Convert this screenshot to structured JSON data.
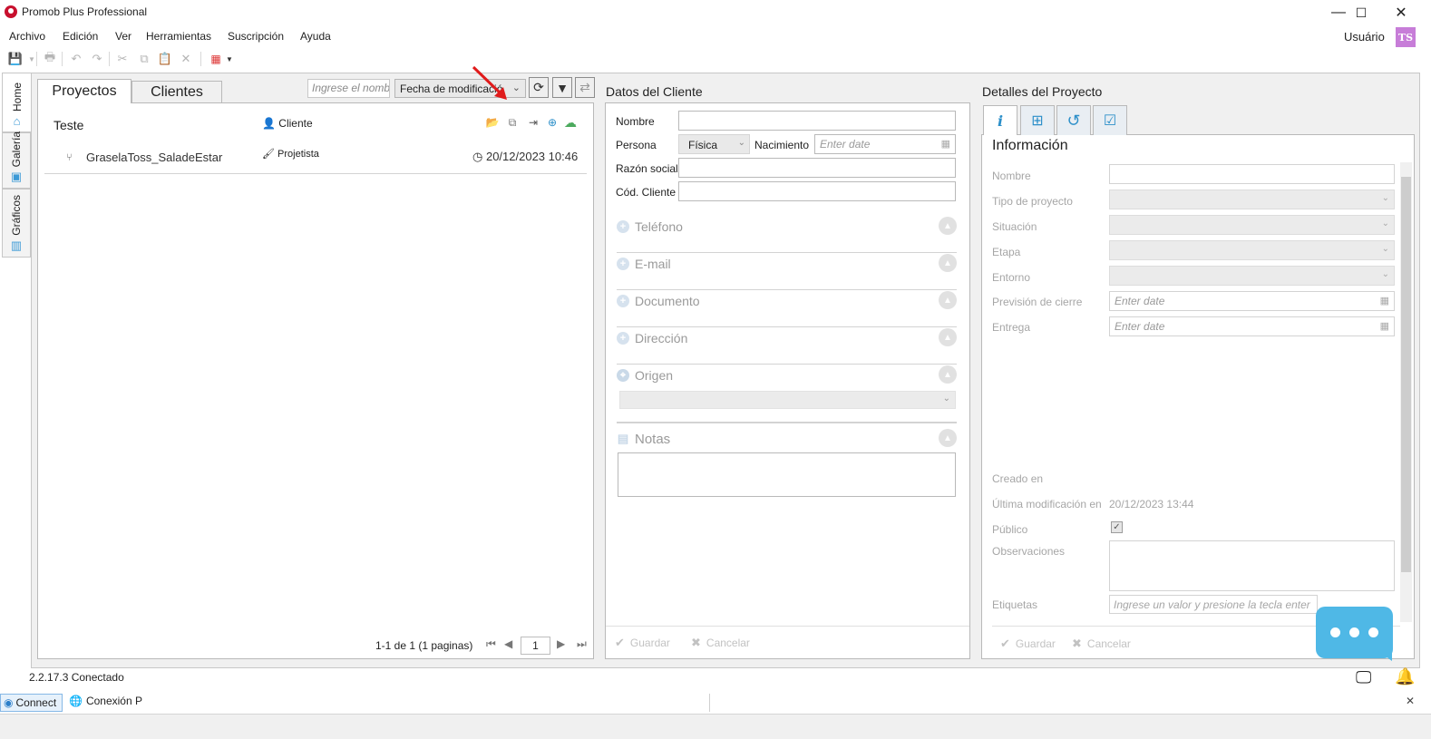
{
  "window": {
    "title": "Promob Plus Professional",
    "minimize": "—",
    "maximize": "☐",
    "close": "✕"
  },
  "menu": {
    "items": [
      "Archivo",
      "Edición",
      "Ver",
      "Herramientas",
      "Suscripción",
      "Ayuda"
    ]
  },
  "user": {
    "label": "Usuário",
    "initials": "TS",
    "avatar_color": "#c77dd8"
  },
  "sidebar": {
    "tabs": [
      {
        "label": "Home",
        "icon": "home-icon"
      },
      {
        "label": "Galería",
        "icon": "gallery-icon"
      },
      {
        "label": "Gráficos",
        "icon": "chart-icon"
      }
    ]
  },
  "projects": {
    "tabs": [
      "Proyectos",
      "Clientes"
    ],
    "search_placeholder": "Ingrese el nombr",
    "sort_value": "Fecha de modificació",
    "project": {
      "name": "Teste",
      "client_label": "Cliente",
      "sub_name": "GraselaToss_SaladeEstar",
      "designer_label": "Projetista",
      "date": "20/12/2023 10:46"
    },
    "pager": {
      "text": "1-1 de 1 (1 paginas)",
      "page": "1"
    }
  },
  "client": {
    "title": "Datos del Cliente",
    "labels": {
      "name": "Nombre",
      "persona": "Persona",
      "birth": "Nacimiento",
      "razon": "Razón social",
      "code": "Cód. Cliente"
    },
    "persona_value": "Física",
    "date_placeholder": "Enter date",
    "sections": [
      "Teléfono",
      "E-mail",
      "Documento",
      "Dirección",
      "Origen",
      "Notas"
    ],
    "save": "Guardar",
    "cancel": "Cancelar"
  },
  "details": {
    "title": "Detalles del Proyecto",
    "heading": "Información",
    "labels": {
      "name": "Nombre",
      "type": "Tipo de proyecto",
      "status": "Situación",
      "stage": "Etapa",
      "environment": "Entorno",
      "close_forecast": "Previsión de cierre",
      "delivery": "Entrega",
      "created": "Creado en",
      "modified": "Última modificación en",
      "public": "Público",
      "notes": "Observaciones",
      "tags": "Etiquetas"
    },
    "modified_value": "20/12/2023 13:44",
    "date_placeholder": "Enter date",
    "tags_placeholder": "Ingrese un valor y presione la tecla enter",
    "save": "Guardar",
    "cancel": "Cancelar"
  },
  "status": {
    "text": "2.2.17.3  Conectado"
  },
  "bottom": {
    "connect": "Connect",
    "conexion": "Conexión P",
    "close": "✕"
  },
  "colors": {
    "accent": "#3c9ad6",
    "chat": "#4fb8e6",
    "arrow": "#e01b1b"
  }
}
